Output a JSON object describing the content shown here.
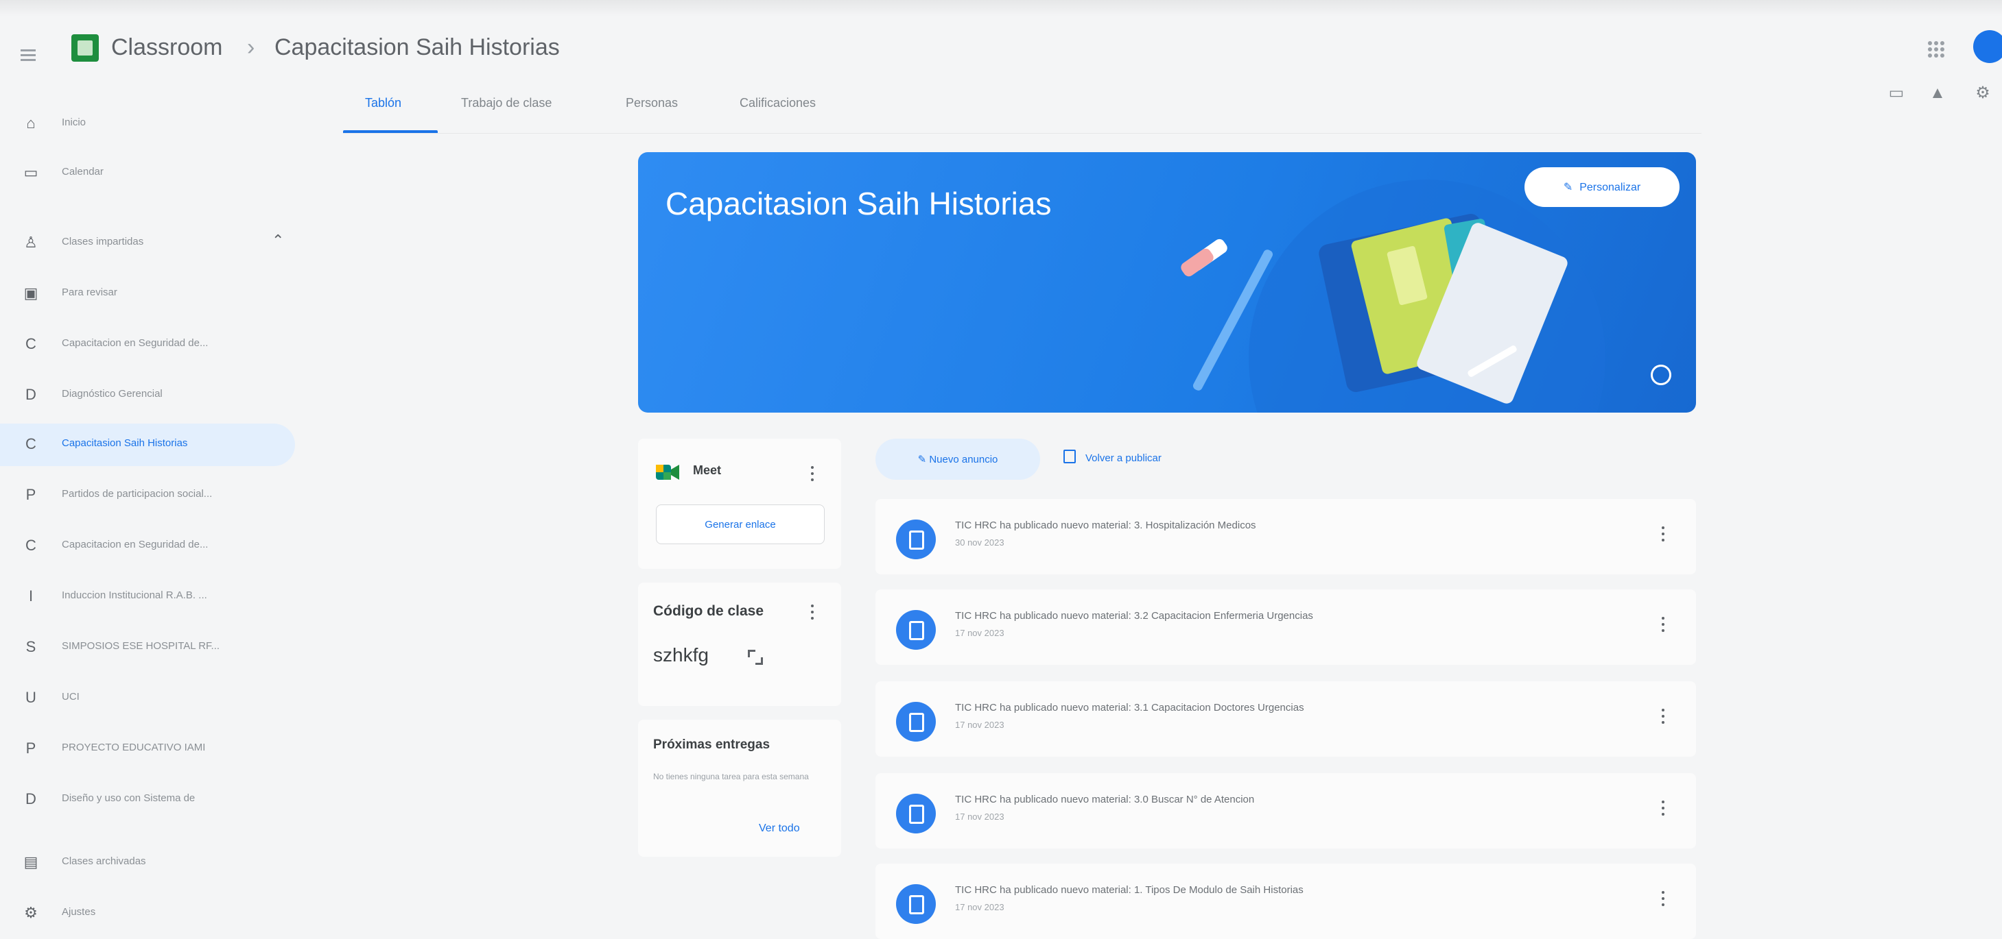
{
  "header": {
    "app_name": "Classroom",
    "separator": "›",
    "class_name": "Capacitasion Saih Historias"
  },
  "tabs": [
    {
      "label": "Tablón"
    },
    {
      "label": "Trabajo de clase"
    },
    {
      "label": "Personas"
    },
    {
      "label": "Calificaciones"
    }
  ],
  "sidebar": {
    "items": [
      {
        "label": "Inicio",
        "icon": "home-icon"
      },
      {
        "label": "Calendar",
        "icon": "calendar-icon"
      },
      {
        "label": "Clases impartidas",
        "icon": "people-icon"
      },
      {
        "label": "Para revisar",
        "icon": "review-icon"
      },
      {
        "label": "Capacitacion en Seguridad de...",
        "letter": "C"
      },
      {
        "label": "Diagnóstico Gerencial",
        "letter": "D"
      },
      {
        "label": "Capacitasion Saih Historias",
        "letter": "C",
        "active": true
      },
      {
        "label": "Partidos de participacion social...",
        "letter": "P"
      },
      {
        "label": "Capacitacion en Seguridad de...",
        "letter": "C"
      },
      {
        "label": "Induccion Institucional R.A.B. ...",
        "letter": "I"
      },
      {
        "label": "SIMPOSIOS ESE HOSPITAL RF...",
        "letter": "S"
      },
      {
        "label": "UCI",
        "letter": "U"
      },
      {
        "label": "PROYECTO EDUCATIVO IAMI",
        "letter": "P"
      },
      {
        "label": "Diseño y uso con Sistema de",
        "letter": "D"
      },
      {
        "label": "Clases archivadas",
        "icon": "archive-icon"
      },
      {
        "label": "Ajustes",
        "icon": "settings-icon"
      }
    ]
  },
  "banner": {
    "title": "Capacitasion Saih Historias",
    "customize_label": "Personalizar",
    "accent": "#1e7de6"
  },
  "meet": {
    "label": "Meet",
    "link_button": "Generar enlace"
  },
  "class_code": {
    "title": "Código de clase",
    "value": "szhkfg"
  },
  "upcoming": {
    "title": "Próximas entregas",
    "empty_text": "No tienes ninguna tarea para esta semana",
    "view_all": "Ver todo"
  },
  "stream": {
    "new_announcement": "Nuevo anuncio",
    "repost": "Volver a publicar",
    "posts": [
      {
        "text": "TIC HRC ha publicado nuevo material: 3. Hospitalización Medicos",
        "date": "30 nov 2023"
      },
      {
        "text": "TIC HRC ha publicado nuevo material: 3.2 Capacitacion Enfermeria Urgencias",
        "date": "17 nov 2023"
      },
      {
        "text": "TIC HRC ha publicado nuevo material: 3.1 Capacitacion Doctores Urgencias",
        "date": "17 nov 2023"
      },
      {
        "text": "TIC HRC ha publicado nuevo material: 3.0 Buscar N° de Atencion",
        "date": "17 nov 2023"
      },
      {
        "text": "TIC HRC ha publicado nuevo material: 1. Tipos De Modulo de Saih Historias",
        "date": "17 nov 2023"
      }
    ]
  },
  "colors": {
    "primary": "#1a73e8",
    "active_bg": "#e3effd"
  }
}
